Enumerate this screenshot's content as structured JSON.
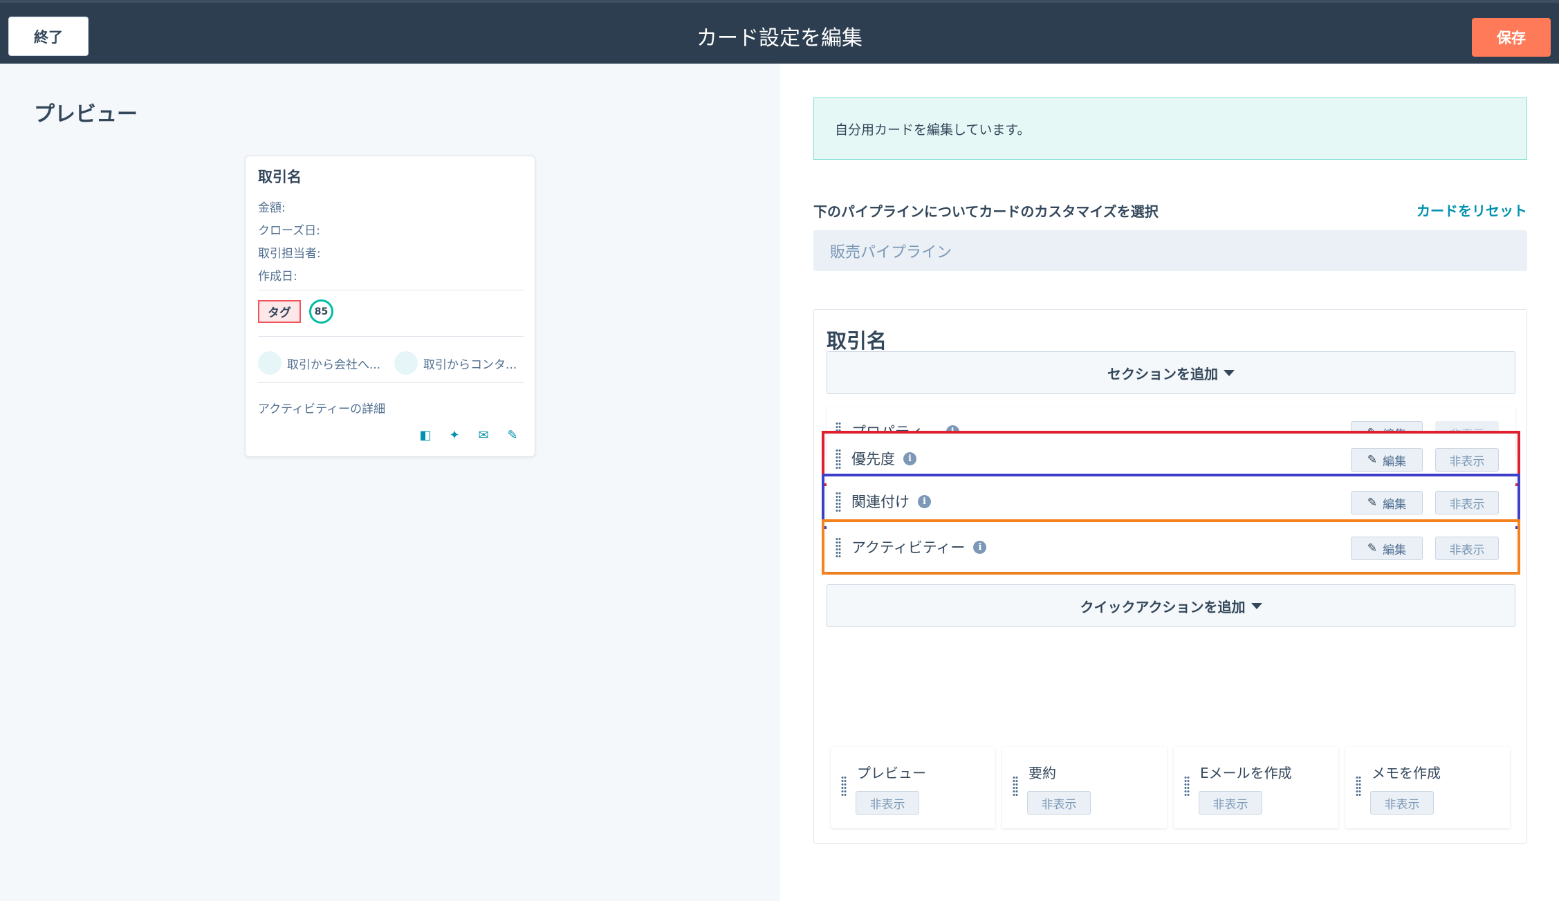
{
  "header": {
    "exit_label": "終了",
    "title": "カード設定を編集",
    "save_label": "保存"
  },
  "preview": {
    "title": "プレビュー",
    "card": {
      "name": "取引名",
      "properties": [
        "金額:",
        "クローズ日:",
        "取引担当者:",
        "作成日:"
      ],
      "tag": "タグ",
      "score": "85",
      "associations": [
        "取引から会社へ...",
        "取引からコンタ..."
      ],
      "activity_label": "アクティビティーの詳細",
      "icons": [
        "panel-icon",
        "sparkle-icon",
        "email-icon",
        "note-icon"
      ]
    }
  },
  "settings": {
    "info_message": "自分用カードを編集しています。",
    "pipeline_label": "下のパイプラインについてカードのカスタマイズを選択",
    "reset_label": "カードをリセット",
    "pipeline_value": "販売パイプライン",
    "editor": {
      "title": "取引名",
      "add_section_label": "セクションを追加",
      "edit_label": "編集",
      "hide_label": "非表示",
      "sections": [
        {
          "label": "プロパティー",
          "highlight": null
        },
        {
          "label": "優先度",
          "highlight": "#e0202e"
        },
        {
          "label": "関連付け",
          "highlight": "#3d3fc9"
        },
        {
          "label": "アクティビティー",
          "highlight": "#f5821f"
        }
      ],
      "add_quick_action_label": "クイックアクションを追加",
      "quick_actions": [
        "プレビュー",
        "要約",
        "Eメールを作成",
        "メモを作成"
      ]
    }
  }
}
